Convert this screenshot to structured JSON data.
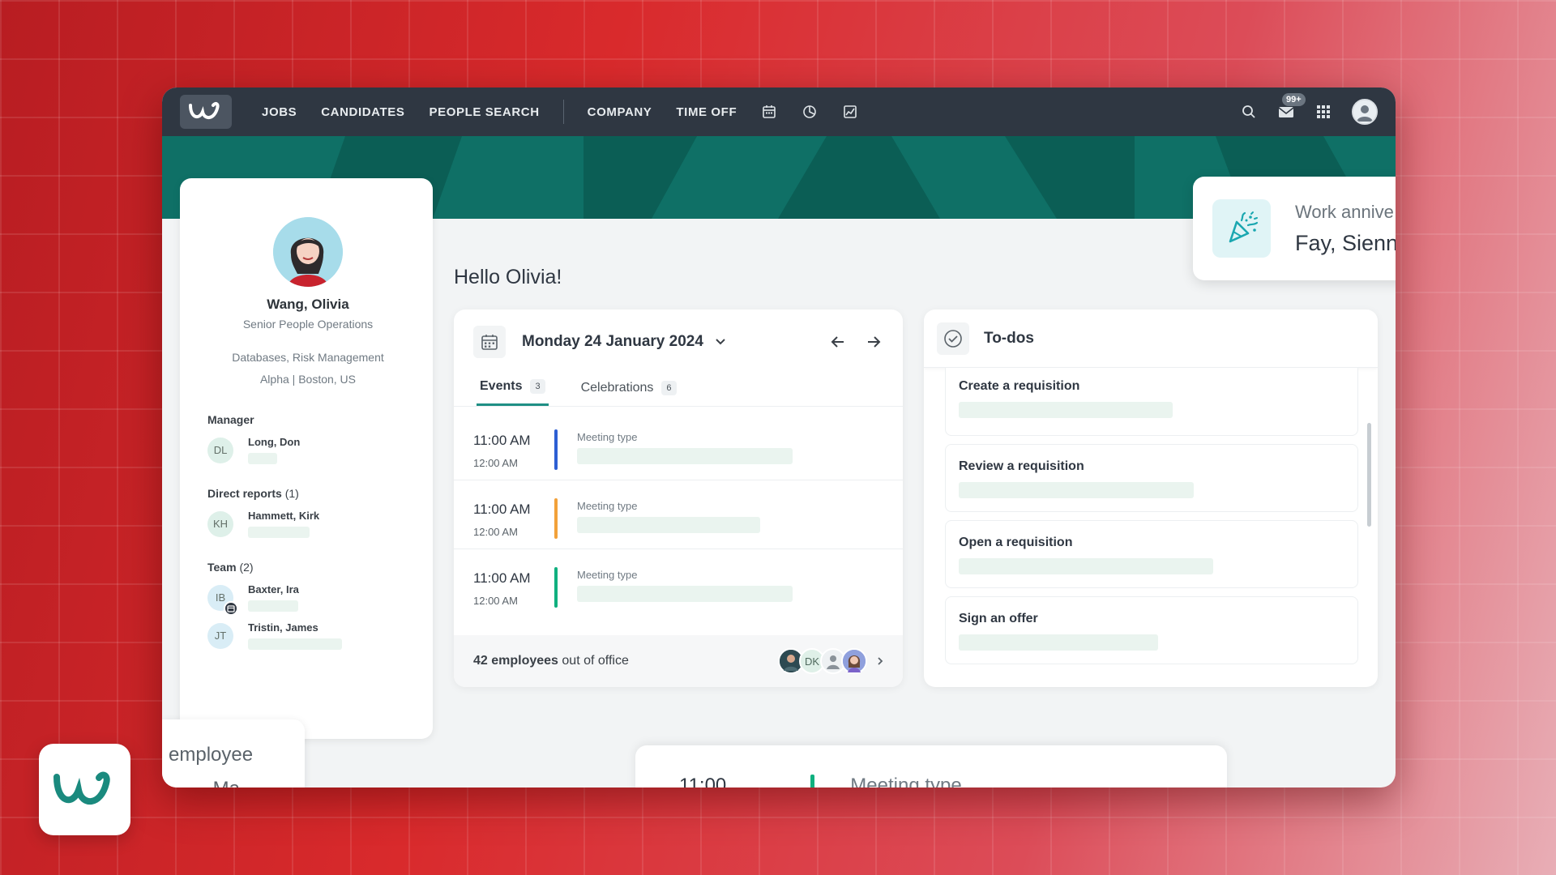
{
  "nav": {
    "links": [
      "JOBS",
      "CANDIDATES",
      "PEOPLE SEARCH",
      "COMPANY",
      "TIME OFF"
    ],
    "icons": [
      "calendar-icon",
      "pie-chart-icon",
      "chart-icon"
    ],
    "notification_count": "99+"
  },
  "profile": {
    "name": "Wang, Olivia",
    "title": "Senior People Operations",
    "tags_line1": "Databases, Risk Management",
    "tags_line2": "Alpha | Boston, US",
    "manager_label": "Manager",
    "manager": {
      "initials": "DL",
      "name": "Long, Don"
    },
    "direct_reports_label": "Direct reports",
    "direct_reports_count": "(1)",
    "direct_reports": [
      {
        "initials": "KH",
        "name": "Hammett, Kirk"
      }
    ],
    "team_label": "Team",
    "team_count": "(2)",
    "team": [
      {
        "initials": "IB",
        "name": "Baxter, Ira"
      },
      {
        "initials": "JT",
        "name": "Tristin, James"
      }
    ]
  },
  "greeting": "Hello Olivia!",
  "events": {
    "date": "Monday 24 January 2024",
    "tabs": [
      {
        "label": "Events",
        "count": "3"
      },
      {
        "label": "Celebrations",
        "count": "6"
      }
    ],
    "items": [
      {
        "time": "11:00 AM",
        "end": "12:00 AM",
        "type": "Meeting type",
        "color": "#2d5fd3"
      },
      {
        "time": "11:00 AM",
        "end": "12:00 AM",
        "type": "Meeting type",
        "color": "#f2a13a"
      },
      {
        "time": "11:00 AM",
        "end": "12:00 AM",
        "type": "Meeting type",
        "color": "#10b07f"
      }
    ],
    "out_of_office_count": "42 employees",
    "out_of_office_suffix": "out of office",
    "ooo_initials": "DK"
  },
  "todos": {
    "title": "To-dos",
    "items": [
      "Create a requisition",
      "Review a requisition",
      "Open a requisition",
      "Sign an offer"
    ]
  },
  "anniversary": {
    "label": "Work annive",
    "name": "Fay, Sienn"
  },
  "bottom": {
    "employee_text": "employee",
    "employee_sub": "- Ma",
    "meeting_time": "11:00",
    "meeting_type": "Meeting type"
  },
  "colors": {
    "nav_bg": "#2f3742",
    "banner": "#0f7066",
    "accent": "#1f8f84",
    "brand": "#1a8a7e"
  }
}
